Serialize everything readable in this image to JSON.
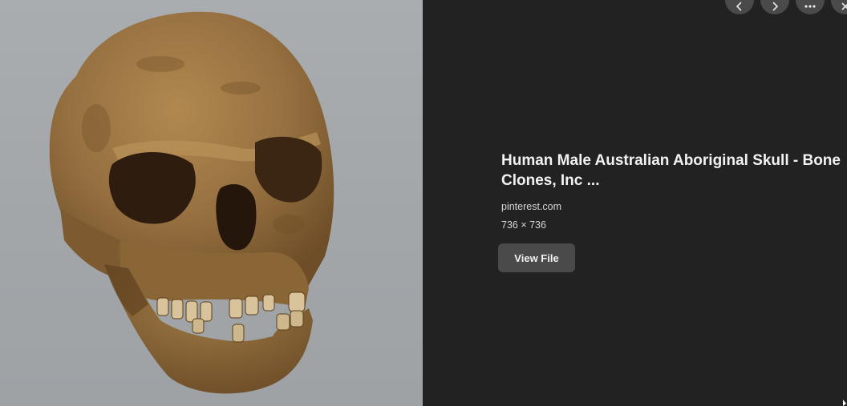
{
  "image": {
    "alt_icon": "skull-photo",
    "background_color": "#a6aaad",
    "bone_color": "#9a7440"
  },
  "result": {
    "title": "Human Male Australian Aboriginal Skull - Bone Clones, Inc ...",
    "source": "pinterest.com",
    "dimensions": "736 × 736",
    "view_file_label": "View File"
  },
  "controls": {
    "prev_icon": "chevron-left-icon",
    "next_icon": "chevron-right-icon",
    "more_icon": "more-horizontal-icon",
    "close_icon": "close-icon"
  },
  "colors": {
    "panel_background": "#222222",
    "button_background": "#4a4a4a",
    "text_primary": "#f2f2f2",
    "text_secondary": "#d6d6d6"
  }
}
